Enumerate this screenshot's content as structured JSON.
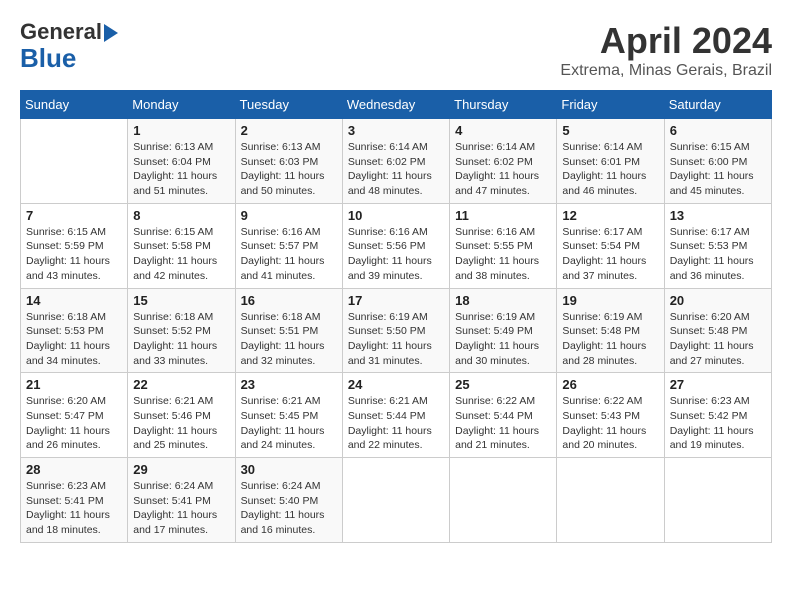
{
  "logo": {
    "line1": "General",
    "line2": "Blue"
  },
  "calendar": {
    "title": "April 2024",
    "subtitle": "Extrema, Minas Gerais, Brazil"
  },
  "weekdays": [
    "Sunday",
    "Monday",
    "Tuesday",
    "Wednesday",
    "Thursday",
    "Friday",
    "Saturday"
  ],
  "weeks": [
    [
      {
        "num": "",
        "info": ""
      },
      {
        "num": "1",
        "info": "Sunrise: 6:13 AM\nSunset: 6:04 PM\nDaylight: 11 hours\nand 51 minutes."
      },
      {
        "num": "2",
        "info": "Sunrise: 6:13 AM\nSunset: 6:03 PM\nDaylight: 11 hours\nand 50 minutes."
      },
      {
        "num": "3",
        "info": "Sunrise: 6:14 AM\nSunset: 6:02 PM\nDaylight: 11 hours\nand 48 minutes."
      },
      {
        "num": "4",
        "info": "Sunrise: 6:14 AM\nSunset: 6:02 PM\nDaylight: 11 hours\nand 47 minutes."
      },
      {
        "num": "5",
        "info": "Sunrise: 6:14 AM\nSunset: 6:01 PM\nDaylight: 11 hours\nand 46 minutes."
      },
      {
        "num": "6",
        "info": "Sunrise: 6:15 AM\nSunset: 6:00 PM\nDaylight: 11 hours\nand 45 minutes."
      }
    ],
    [
      {
        "num": "7",
        "info": "Sunrise: 6:15 AM\nSunset: 5:59 PM\nDaylight: 11 hours\nand 43 minutes."
      },
      {
        "num": "8",
        "info": "Sunrise: 6:15 AM\nSunset: 5:58 PM\nDaylight: 11 hours\nand 42 minutes."
      },
      {
        "num": "9",
        "info": "Sunrise: 6:16 AM\nSunset: 5:57 PM\nDaylight: 11 hours\nand 41 minutes."
      },
      {
        "num": "10",
        "info": "Sunrise: 6:16 AM\nSunset: 5:56 PM\nDaylight: 11 hours\nand 39 minutes."
      },
      {
        "num": "11",
        "info": "Sunrise: 6:16 AM\nSunset: 5:55 PM\nDaylight: 11 hours\nand 38 minutes."
      },
      {
        "num": "12",
        "info": "Sunrise: 6:17 AM\nSunset: 5:54 PM\nDaylight: 11 hours\nand 37 minutes."
      },
      {
        "num": "13",
        "info": "Sunrise: 6:17 AM\nSunset: 5:53 PM\nDaylight: 11 hours\nand 36 minutes."
      }
    ],
    [
      {
        "num": "14",
        "info": "Sunrise: 6:18 AM\nSunset: 5:53 PM\nDaylight: 11 hours\nand 34 minutes."
      },
      {
        "num": "15",
        "info": "Sunrise: 6:18 AM\nSunset: 5:52 PM\nDaylight: 11 hours\nand 33 minutes."
      },
      {
        "num": "16",
        "info": "Sunrise: 6:18 AM\nSunset: 5:51 PM\nDaylight: 11 hours\nand 32 minutes."
      },
      {
        "num": "17",
        "info": "Sunrise: 6:19 AM\nSunset: 5:50 PM\nDaylight: 11 hours\nand 31 minutes."
      },
      {
        "num": "18",
        "info": "Sunrise: 6:19 AM\nSunset: 5:49 PM\nDaylight: 11 hours\nand 30 minutes."
      },
      {
        "num": "19",
        "info": "Sunrise: 6:19 AM\nSunset: 5:48 PM\nDaylight: 11 hours\nand 28 minutes."
      },
      {
        "num": "20",
        "info": "Sunrise: 6:20 AM\nSunset: 5:48 PM\nDaylight: 11 hours\nand 27 minutes."
      }
    ],
    [
      {
        "num": "21",
        "info": "Sunrise: 6:20 AM\nSunset: 5:47 PM\nDaylight: 11 hours\nand 26 minutes."
      },
      {
        "num": "22",
        "info": "Sunrise: 6:21 AM\nSunset: 5:46 PM\nDaylight: 11 hours\nand 25 minutes."
      },
      {
        "num": "23",
        "info": "Sunrise: 6:21 AM\nSunset: 5:45 PM\nDaylight: 11 hours\nand 24 minutes."
      },
      {
        "num": "24",
        "info": "Sunrise: 6:21 AM\nSunset: 5:44 PM\nDaylight: 11 hours\nand 22 minutes."
      },
      {
        "num": "25",
        "info": "Sunrise: 6:22 AM\nSunset: 5:44 PM\nDaylight: 11 hours\nand 21 minutes."
      },
      {
        "num": "26",
        "info": "Sunrise: 6:22 AM\nSunset: 5:43 PM\nDaylight: 11 hours\nand 20 minutes."
      },
      {
        "num": "27",
        "info": "Sunrise: 6:23 AM\nSunset: 5:42 PM\nDaylight: 11 hours\nand 19 minutes."
      }
    ],
    [
      {
        "num": "28",
        "info": "Sunrise: 6:23 AM\nSunset: 5:41 PM\nDaylight: 11 hours\nand 18 minutes."
      },
      {
        "num": "29",
        "info": "Sunrise: 6:24 AM\nSunset: 5:41 PM\nDaylight: 11 hours\nand 17 minutes."
      },
      {
        "num": "30",
        "info": "Sunrise: 6:24 AM\nSunset: 5:40 PM\nDaylight: 11 hours\nand 16 minutes."
      },
      {
        "num": "",
        "info": ""
      },
      {
        "num": "",
        "info": ""
      },
      {
        "num": "",
        "info": ""
      },
      {
        "num": "",
        "info": ""
      }
    ]
  ]
}
